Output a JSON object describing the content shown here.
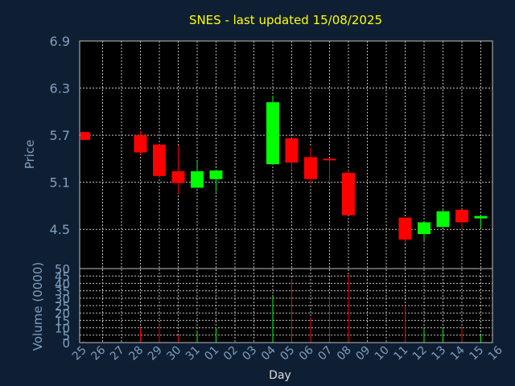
{
  "title": "SNES - last updated 15/08/2025",
  "colors": {
    "background": "#0f1f33",
    "plot_background": "#000000",
    "grid": "#bfbfbf",
    "up": "#00ff00",
    "down": "#ff0000",
    "title": "#ffff00",
    "axis_text": "#7f9fbf"
  },
  "chart_data": [
    {
      "type": "candlestick",
      "ylabel": "Price",
      "ylim": [
        4.0,
        6.9
      ],
      "yticks": [
        "6.9",
        "6.3",
        "5.7",
        "5.1",
        "4.5"
      ],
      "ytick_values": [
        6.9,
        6.3,
        5.7,
        5.1,
        4.5
      ],
      "categories": [
        "25",
        "26",
        "27",
        "28",
        "29",
        "30",
        "31",
        "01",
        "02",
        "03",
        "04",
        "05",
        "06",
        "07",
        "08",
        "09",
        "10",
        "11",
        "12",
        "13",
        "14",
        "15",
        "16"
      ],
      "candles": [
        {
          "x": "25",
          "open": 5.74,
          "close": 5.64,
          "high": 5.74,
          "low": 5.64
        },
        {
          "x": "28",
          "open": 5.7,
          "close": 5.48,
          "high": 5.75,
          "low": 5.45
        },
        {
          "x": "29",
          "open": 5.58,
          "close": 5.18,
          "high": 5.58,
          "low": 5.15
        },
        {
          "x": "30",
          "open": 5.24,
          "close": 5.09,
          "high": 5.57,
          "low": 4.95
        },
        {
          "x": "31",
          "open": 5.03,
          "close": 5.24,
          "high": 5.37,
          "low": 5.03
        },
        {
          "x": "01",
          "open": 5.14,
          "close": 5.25,
          "high": 5.25,
          "low": 4.98
        },
        {
          "x": "04",
          "open": 5.33,
          "close": 6.12,
          "high": 6.2,
          "low": 5.33
        },
        {
          "x": "05",
          "open": 5.66,
          "close": 5.35,
          "high": 5.66,
          "low": 5.25
        },
        {
          "x": "06",
          "open": 5.42,
          "close": 5.14,
          "high": 5.55,
          "low": 5.08
        },
        {
          "x": "07",
          "open": 5.4,
          "close": 5.38,
          "high": 5.4,
          "low": 5.12
        },
        {
          "x": "08",
          "open": 5.22,
          "close": 4.68,
          "high": 5.25,
          "low": 4.68
        },
        {
          "x": "11",
          "open": 4.65,
          "close": 4.37,
          "high": 4.65,
          "low": 4.32
        },
        {
          "x": "12",
          "open": 4.44,
          "close": 4.59,
          "high": 4.59,
          "low": 4.35
        },
        {
          "x": "13",
          "open": 4.53,
          "close": 4.73,
          "high": 4.76,
          "low": 4.53
        },
        {
          "x": "14",
          "open": 4.75,
          "close": 4.59,
          "high": 4.75,
          "low": 4.5
        },
        {
          "x": "15",
          "open": 4.64,
          "close": 4.67,
          "high": 4.67,
          "low": 4.52
        }
      ]
    },
    {
      "type": "bar",
      "ylabel": "Volume (0000)",
      "xlabel": "Day",
      "ylim": [
        0,
        50
      ],
      "yticks": [
        "50",
        "45",
        "40",
        "35",
        "30",
        "25",
        "20",
        "15",
        "10",
        "5",
        "0"
      ],
      "ytick_values": [
        50,
        45,
        40,
        35,
        30,
        25,
        20,
        15,
        10,
        5,
        0
      ],
      "bars": [
        {
          "x": "25",
          "value": 1,
          "direction": "down"
        },
        {
          "x": "28",
          "value": 10,
          "direction": "down"
        },
        {
          "x": "29",
          "value": 12,
          "direction": "down"
        },
        {
          "x": "30",
          "value": 5,
          "direction": "down"
        },
        {
          "x": "31",
          "value": 8,
          "direction": "up"
        },
        {
          "x": "01",
          "value": 10,
          "direction": "up"
        },
        {
          "x": "04",
          "value": 31,
          "direction": "up"
        },
        {
          "x": "05",
          "value": 43,
          "direction": "down"
        },
        {
          "x": "06",
          "value": 17,
          "direction": "down"
        },
        {
          "x": "07",
          "value": 32,
          "direction": "down"
        },
        {
          "x": "08",
          "value": 46,
          "direction": "down"
        },
        {
          "x": "11",
          "value": 25,
          "direction": "down"
        },
        {
          "x": "12",
          "value": 9,
          "direction": "up"
        },
        {
          "x": "13",
          "value": 9,
          "direction": "up"
        },
        {
          "x": "14",
          "value": 10,
          "direction": "down"
        },
        {
          "x": "15",
          "value": 5,
          "direction": "up"
        }
      ]
    }
  ]
}
